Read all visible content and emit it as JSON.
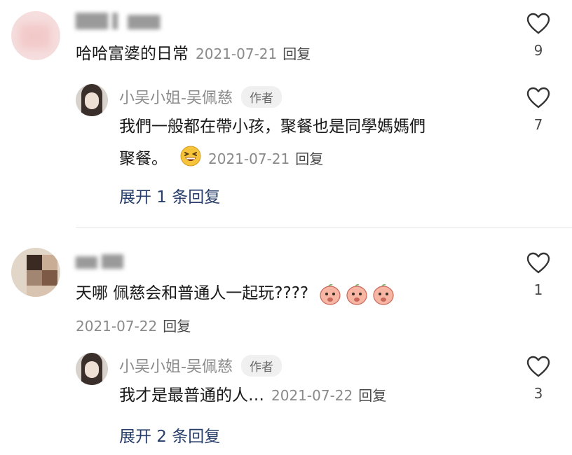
{
  "comments": [
    {
      "user_name": "███ ▌ ▇▇▇",
      "text": "哈哈富婆的日常",
      "date": "2021-07-21",
      "reply_label": "回复",
      "like_count": "9",
      "reply": {
        "user_name": "小吴小姐-吴佩慈",
        "author_tag": "作者",
        "text_line1": "我們一般都在帶小孩，聚餐也是同學媽媽們",
        "text_line2": "聚餐。",
        "emoji": "grinning-squint-emoji",
        "date": "2021-07-21",
        "reply_label": "回复",
        "like_count": "7"
      },
      "expand_label": "展开 1 条回复"
    },
    {
      "user_name": "▆▆ ▇▇",
      "text": "天哪 佩慈会和普通人一起玩????",
      "date": "2021-07-22",
      "reply_label": "回复",
      "like_count": "1",
      "reply": {
        "user_name": "小吴小姐-吴佩慈",
        "author_tag": "作者",
        "text": "我才是最普通的人…",
        "date": "2021-07-22",
        "reply_label": "回复",
        "like_count": "3"
      },
      "expand_label": "展开 2 条回复"
    }
  ],
  "colors": {
    "link": "#283e6a",
    "meta": "#8a8a8a",
    "text": "#1a1a1a"
  }
}
